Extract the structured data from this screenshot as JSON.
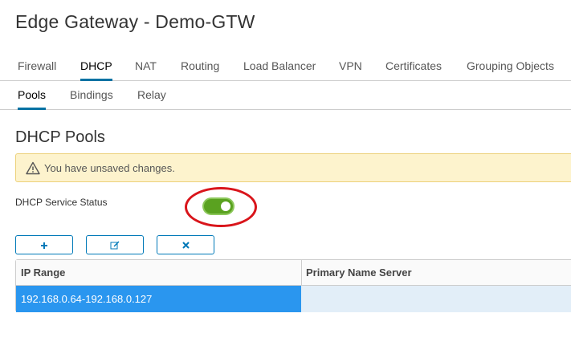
{
  "page": {
    "title": "Edge Gateway - Demo-GTW"
  },
  "tabs": [
    {
      "label": "Firewall",
      "active": false
    },
    {
      "label": "DHCP",
      "active": true
    },
    {
      "label": "NAT",
      "active": false
    },
    {
      "label": "Routing",
      "active": false
    },
    {
      "label": "Load Balancer",
      "active": false
    },
    {
      "label": "VPN",
      "active": false
    },
    {
      "label": "Certificates",
      "active": false
    },
    {
      "label": "Grouping Objects",
      "active": false
    }
  ],
  "subtabs": [
    {
      "label": "Pools",
      "active": true
    },
    {
      "label": "Bindings",
      "active": false
    },
    {
      "label": "Relay",
      "active": false
    }
  ],
  "section": {
    "title": "DHCP Pools"
  },
  "alert": {
    "icon": "warning-icon",
    "text": "You have unsaved changes."
  },
  "service_status": {
    "label": "DHCP Service Status",
    "enabled": true,
    "color_on": "#5aa220"
  },
  "toolbar": {
    "add_icon": "plus-icon",
    "edit_icon": "edit-icon",
    "delete_icon": "close-icon"
  },
  "grid": {
    "columns": [
      "IP Range",
      "Primary Name Server"
    ],
    "rows": [
      {
        "ip_range": "192.168.0.64-192.168.0.127",
        "primary_name_server": "",
        "selected": true
      }
    ]
  },
  "colors": {
    "accent": "#0079b8",
    "selected_row": "#2a96ef",
    "alert_bg": "#fdf3cd",
    "annotation_ring": "#d9151b"
  }
}
